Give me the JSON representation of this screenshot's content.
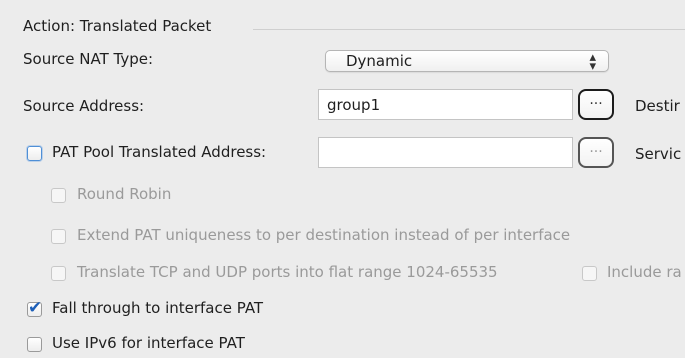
{
  "section": {
    "title": "Action: Translated Packet"
  },
  "source_nat_type": {
    "label": "Source NAT Type:",
    "value": "Dynamic",
    "arrows_icon": "up-down-arrows-icon"
  },
  "source_address": {
    "label": "Source Address:",
    "value": "group1",
    "browse_label": "...",
    "right_label_partial": "Destir"
  },
  "pat_pool": {
    "label": "PAT Pool Translated Address:",
    "value": "",
    "checked": false,
    "browse_label": "...",
    "right_label_partial": "Servic"
  },
  "round_robin": {
    "label": "Round Robin",
    "checked": false
  },
  "extend_pat": {
    "label": "Extend PAT uniqueness to per destination instead of per interface",
    "checked": false
  },
  "flat_range": {
    "label": "Translate TCP and UDP ports into flat range 1024-65535",
    "checked": false
  },
  "include_range": {
    "label": "Include ra",
    "checked": false
  },
  "fall_through": {
    "label": "Fall through to interface PAT",
    "checked": true,
    "check_glyph": "✔"
  },
  "ipv6": {
    "label": "Use IPv6 for interface PAT",
    "checked": false
  },
  "colors": {
    "accent": "#4f8fd6",
    "background": "#ececec",
    "disabled_text": "#9a9a9a"
  }
}
